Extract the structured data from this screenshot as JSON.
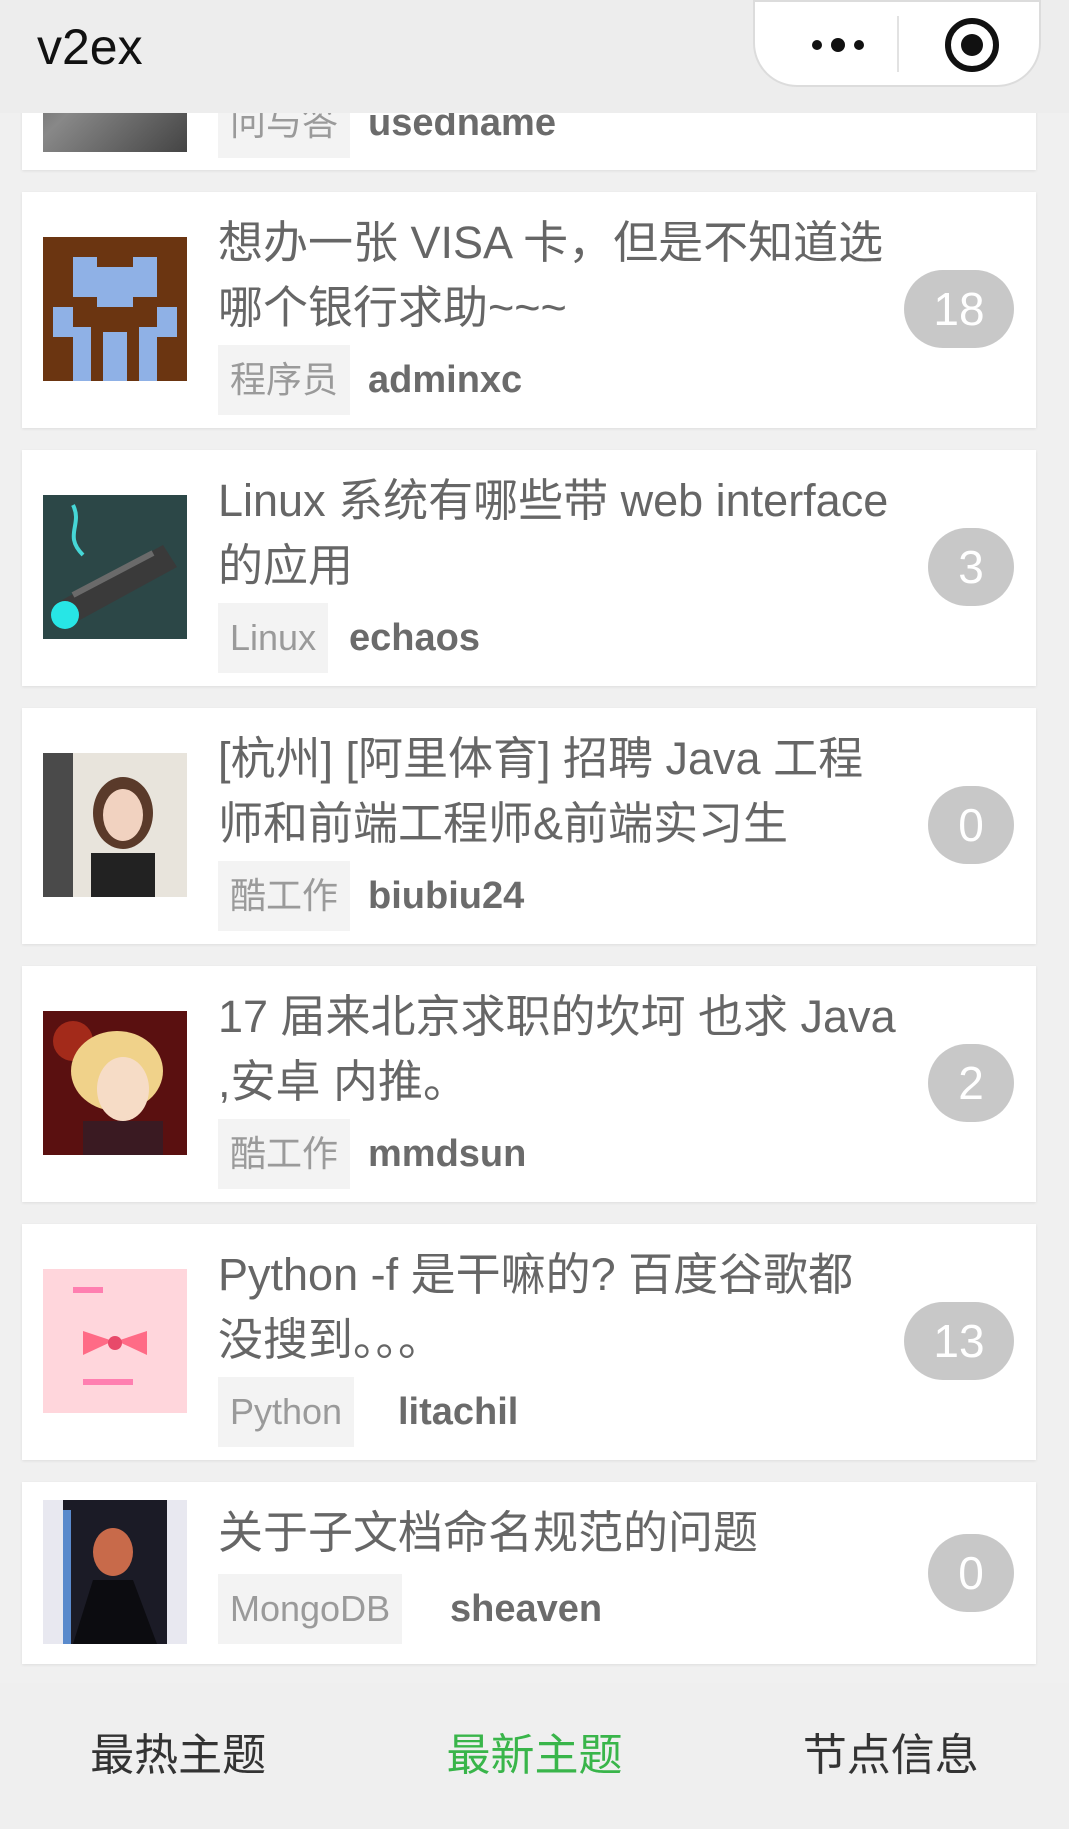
{
  "navbar": {
    "title": "v2ex"
  },
  "capsule": {
    "more_icon": "more-dots-icon",
    "close_icon": "target-close-icon"
  },
  "topics": [
    {
      "title": "",
      "node": "问与答",
      "author": "usedname",
      "replies": ""
    },
    {
      "title": "想办一张 VISA 卡，但是不知道选哪个银行求助~~~",
      "node": "程序员",
      "author": "adminxc",
      "replies": "18"
    },
    {
      "title": "Linux 系统有哪些带 web interface 的应用",
      "node": "Linux",
      "author": "echaos",
      "replies": "3"
    },
    {
      "title": "[杭州] [阿里体育] 招聘 Java 工程师和前端工程师&前端实习生",
      "node": "酷工作",
      "author": "biubiu24",
      "replies": "0"
    },
    {
      "title": "17 届来北京求职的坎坷 也求 Java ,安卓 内推。",
      "node": "酷工作",
      "author": "mmdsun",
      "replies": "2"
    },
    {
      "title": "Python -f 是干嘛的? 百度谷歌都没搜到。。。",
      "node": "Python",
      "author": "litachil",
      "replies": "13"
    },
    {
      "title": "关于子文档命名规范的问题",
      "node": "MongoDB",
      "author": "sheaven",
      "replies": "0"
    }
  ],
  "tabbar": {
    "tabs": [
      {
        "label": "最热主题",
        "active": false
      },
      {
        "label": "最新主题",
        "active": true
      },
      {
        "label": "节点信息",
        "active": false
      }
    ],
    "active_color": "#39b54a"
  }
}
